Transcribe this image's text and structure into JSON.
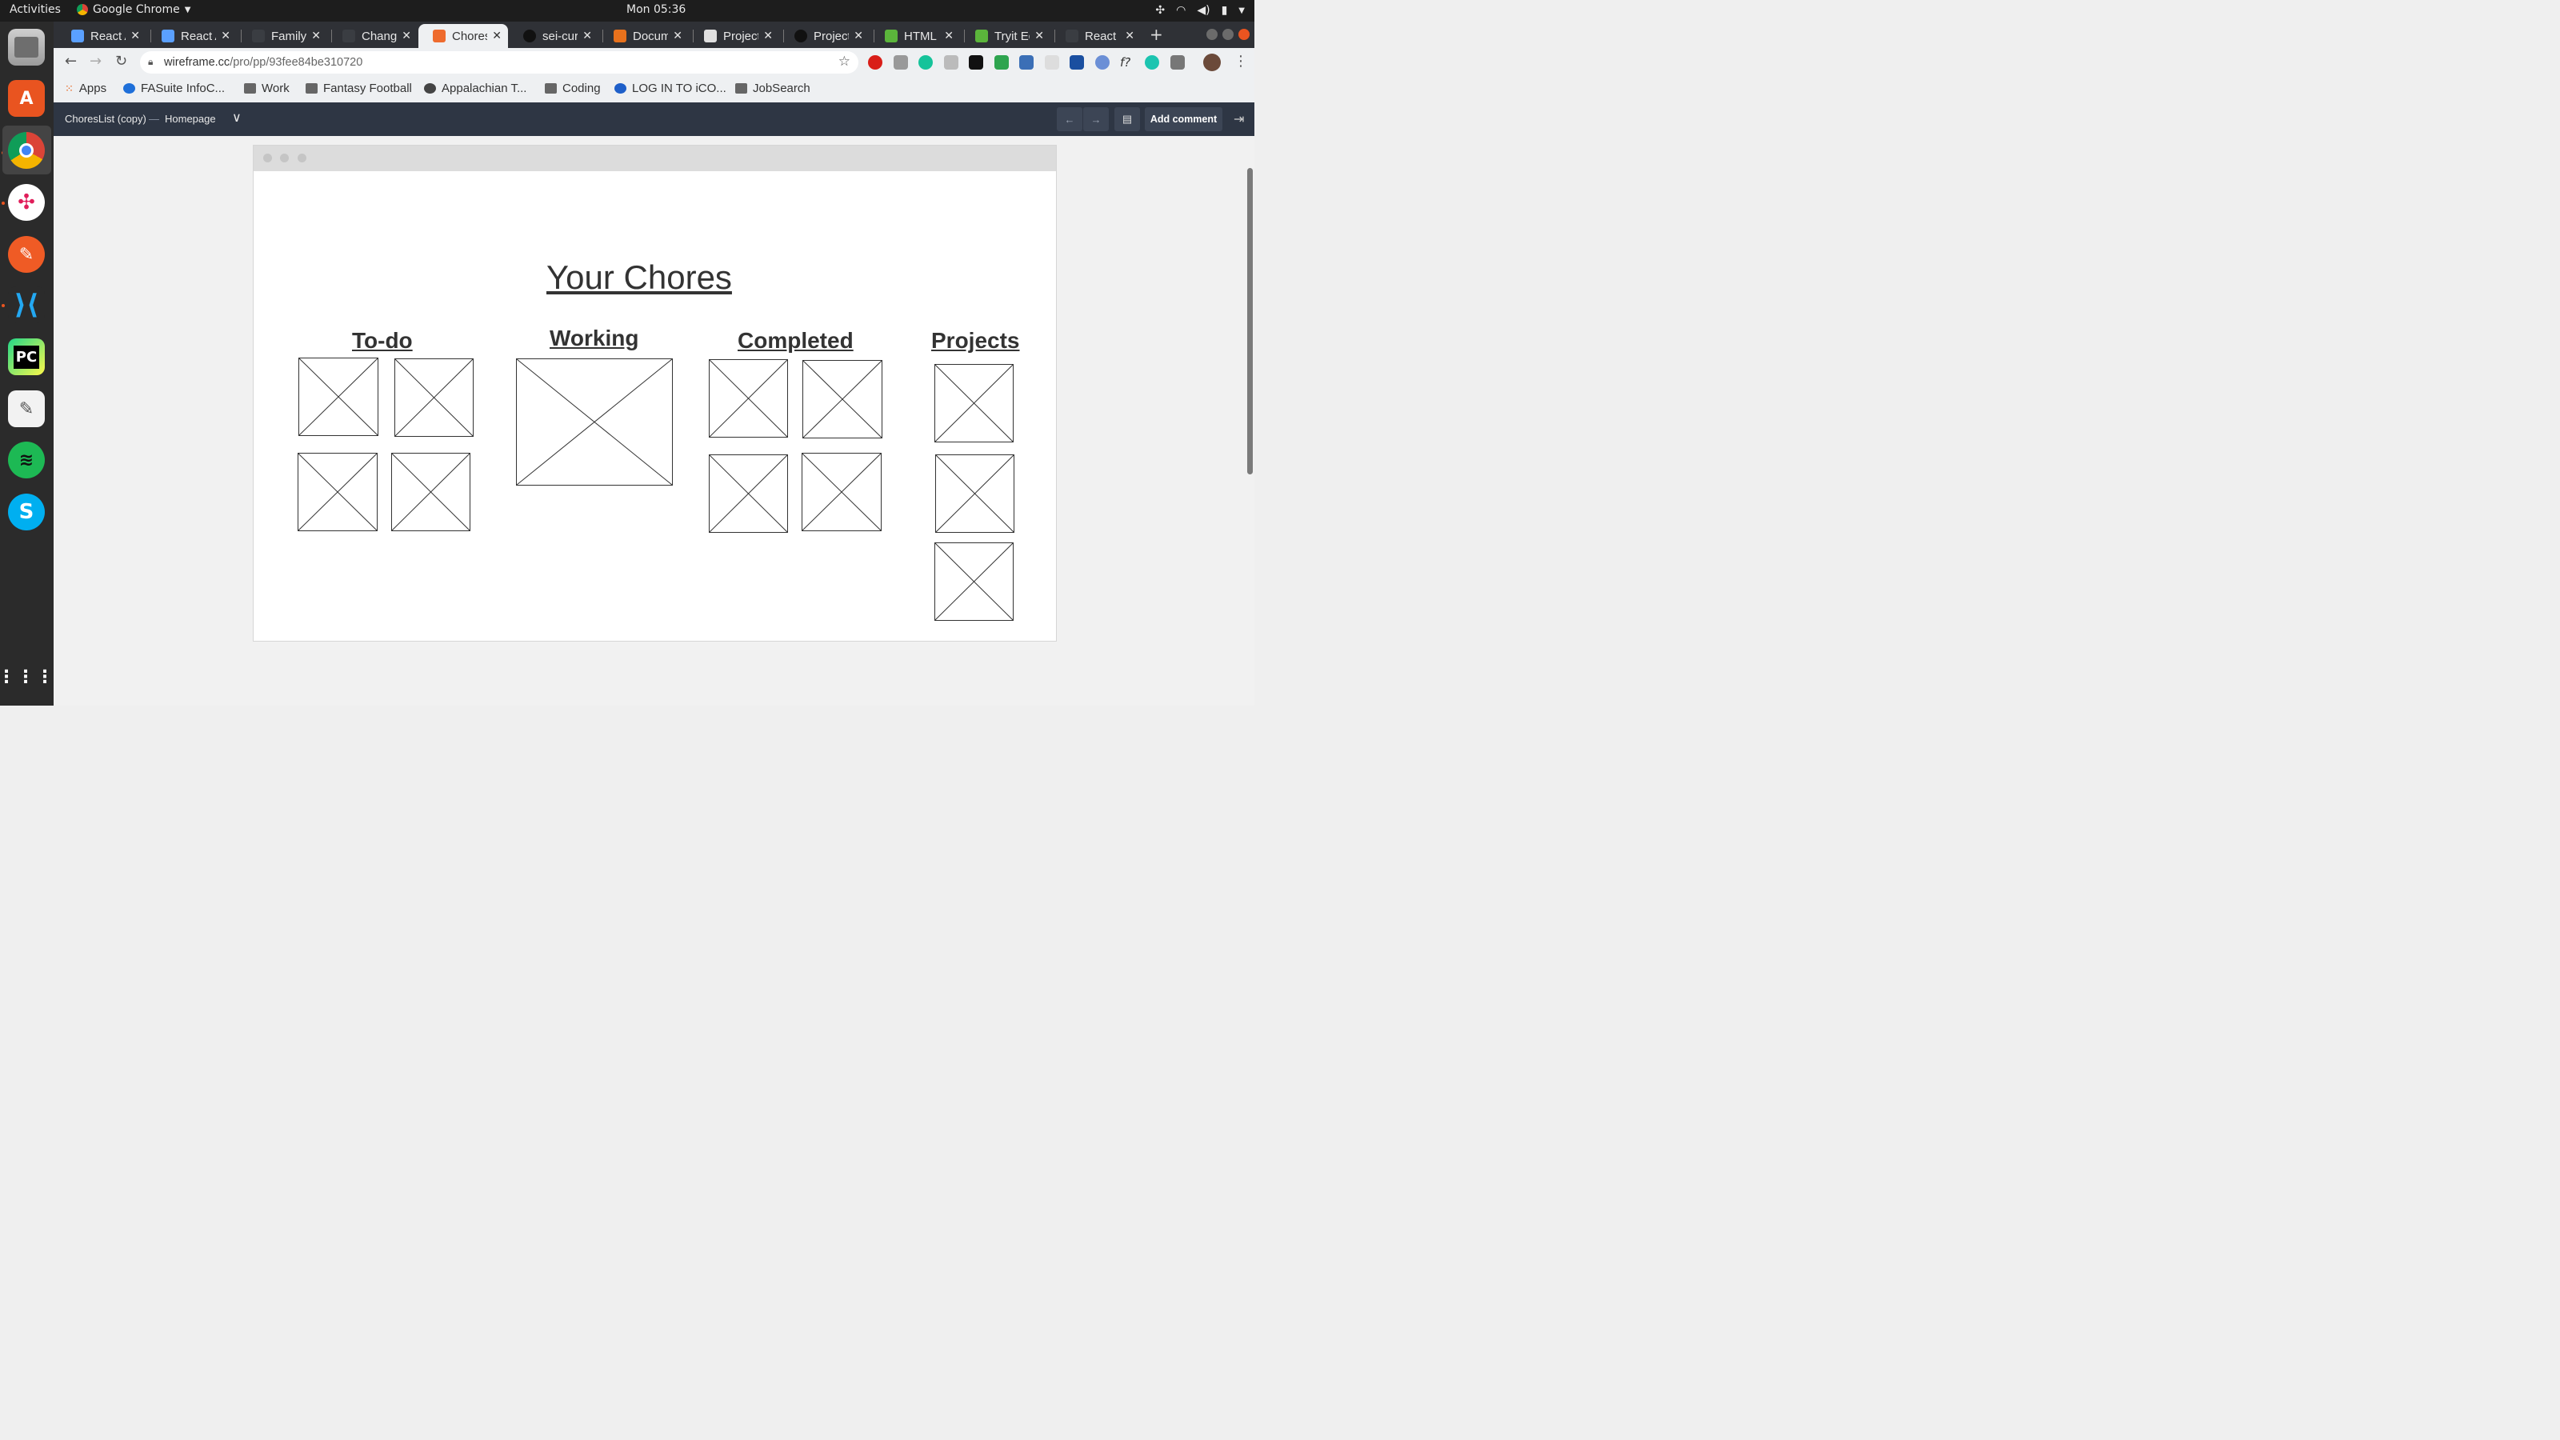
{
  "system": {
    "activities": "Activities",
    "app_name": "Google Chrome",
    "clock": "Mon 05:36"
  },
  "tabs": [
    {
      "label": "React A",
      "icon_color": "#5aa0ff"
    },
    {
      "label": "React A",
      "icon_color": "#5aa0ff"
    },
    {
      "label": "Family I",
      "icon_color": "#3a3d42"
    },
    {
      "label": "Change",
      "icon_color": "#3a3d42"
    },
    {
      "label": "ChoresL",
      "icon_color": "#ee6b2d",
      "active": true
    },
    {
      "label": "sei-curr",
      "icon_color": "#111"
    },
    {
      "label": "Docume",
      "icon_color": "#e8711c"
    },
    {
      "label": "Project",
      "icon_color": "#e0e0e0"
    },
    {
      "label": "Project",
      "icon_color": "#111"
    },
    {
      "label": "HTML s",
      "icon_color": "#5bb53b"
    },
    {
      "label": "Tryit Ed",
      "icon_color": "#5bb53b"
    },
    {
      "label": "React d",
      "icon_color": "#3a3d42"
    }
  ],
  "address": {
    "host": "wireframe.cc",
    "path": "/pro/pp/93fee84be310720"
  },
  "bookmarks": [
    {
      "label": "Apps",
      "icon": "apps-grid-icon"
    },
    {
      "label": "FASuite InfoC...",
      "icon": "globe-icon"
    },
    {
      "label": "Work",
      "icon": "folder-icon"
    },
    {
      "label": "Fantasy Football",
      "icon": "folder-icon"
    },
    {
      "label": "Appalachian T...",
      "icon": "globe-icon"
    },
    {
      "label": "Coding",
      "icon": "folder-icon"
    },
    {
      "label": "LOG IN TO iCO...",
      "icon": "icon-logo"
    },
    {
      "label": "JobSearch",
      "icon": "folder-icon"
    }
  ],
  "wireframe_bar": {
    "project": "ChoresList (copy)",
    "separator": "—",
    "page": "Homepage",
    "add_comment": "Add comment"
  },
  "wireframe": {
    "title": "Your Chores",
    "columns": [
      {
        "heading": "To-do",
        "placeholders": 4
      },
      {
        "heading": "Working",
        "placeholders": 1
      },
      {
        "heading": "Completed",
        "placeholders": 4
      },
      {
        "heading": "Projects",
        "placeholders": 3
      }
    ]
  },
  "colors": {
    "ubuntu_orange": "#e95420",
    "wireframe_bar": "#2e3644",
    "tab_strip": "#2f3136"
  }
}
